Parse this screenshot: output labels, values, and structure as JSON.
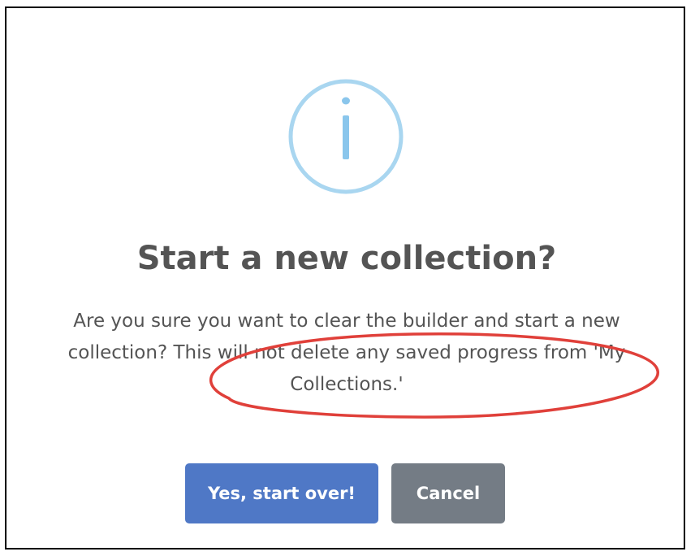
{
  "dialog": {
    "icon": "info-icon",
    "icon_color": "#a9d6f0",
    "title": "Start a new collection?",
    "message": "Are you sure you want to clear the builder and start a new collection? This will not delete any saved progress from 'My Collections.'",
    "annotation_color": "#e0403a",
    "buttons": {
      "confirm_label": "Yes, start over!",
      "confirm_color": "#4f78c6",
      "cancel_label": "Cancel",
      "cancel_color": "#747c85"
    }
  }
}
